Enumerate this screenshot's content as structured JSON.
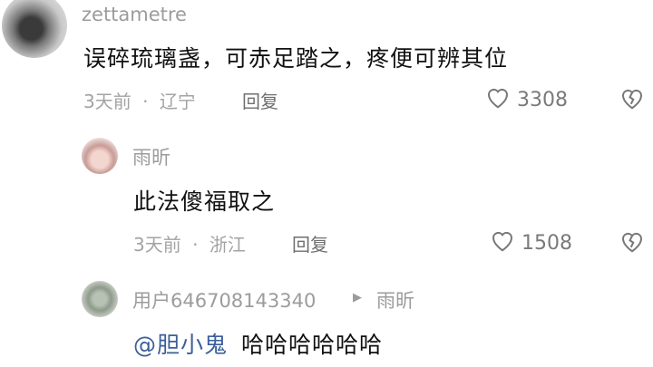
{
  "comments": [
    {
      "username": "zettametre",
      "text": "误碎琉璃盏，可赤足踏之，疼便可辨其位",
      "time": "3天前",
      "location": "辽宁",
      "reply_label": "回复",
      "likes": "3308"
    },
    {
      "username": "雨昕",
      "text": "此法傻福取之",
      "time": "3天前",
      "location": "浙江",
      "reply_label": "回复",
      "likes": "1508"
    },
    {
      "username": "用户646708143340",
      "reply_to": "雨昕",
      "mention": "@胆小鬼",
      "text": "哈哈哈哈哈哈"
    }
  ],
  "separator": "·",
  "icons": {
    "like": "heart-outline-icon",
    "dislike": "broken-heart-icon",
    "reply_arrow": "triangle-right-icon"
  }
}
